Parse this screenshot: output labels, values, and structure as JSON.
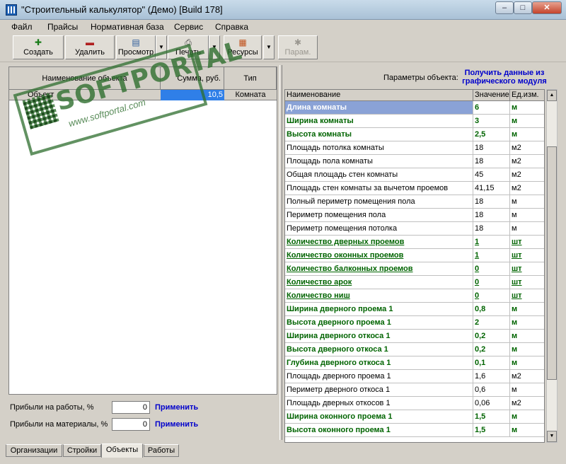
{
  "window": {
    "title": "\"Строительный калькулятор\" (Демо) [Build 178]",
    "minimize": "–",
    "maximize": "□",
    "close": "✕"
  },
  "menu": [
    "Файл",
    "Прайсы",
    "Нормативная база",
    "Сервис",
    "Справка"
  ],
  "toolbar": {
    "create": "Создать",
    "delete": "Удалить",
    "preview": "Просмотр",
    "print": "Печать",
    "resources": "Ресурсы",
    "params": "Парам.",
    "arrow": "▼"
  },
  "left_table": {
    "headers": [
      "Наименование объекта",
      "Сумма, руб.",
      "Тип"
    ],
    "rows": [
      {
        "name": "Объект",
        "sum": "10,5",
        "type": "Комната"
      }
    ]
  },
  "left_bottom": {
    "profit_work_label": "Прибыли на работы, %",
    "profit_work_value": "0",
    "profit_material_label": "Прибыли на материалы, %",
    "profit_material_value": "0",
    "apply": "Применить"
  },
  "tabs": [
    "Организации",
    "Стройки",
    "Объекты",
    "Работы"
  ],
  "right": {
    "params_label": "Параметры объекта:",
    "get_data_link": "Получить данные из графического модуля",
    "headers": [
      "Наименование",
      "Значение",
      "Ед.изм."
    ],
    "rows": [
      {
        "name": "Длина комнаты",
        "value": "6",
        "unit": "м",
        "style": "sel"
      },
      {
        "name": "Ширина комнаты",
        "value": "3",
        "unit": "м",
        "style": "editable"
      },
      {
        "name": "Высота комнаты",
        "value": "2,5",
        "unit": "м",
        "style": "editable"
      },
      {
        "name": "Площадь потолка комнаты",
        "value": "18",
        "unit": "м2",
        "style": "plain"
      },
      {
        "name": "Площадь пола комнаты",
        "value": "18",
        "unit": "м2",
        "style": "plain"
      },
      {
        "name": "Общая площадь стен комнаты",
        "value": "45",
        "unit": "м2",
        "style": "plain"
      },
      {
        "name": "Площадь стен комнаты за вычетом проемов",
        "value": "41,15",
        "unit": "м2",
        "style": "plain"
      },
      {
        "name": "Полный периметр помещения пола",
        "value": "18",
        "unit": "м",
        "style": "plain"
      },
      {
        "name": "Периметр помещения пола",
        "value": "18",
        "unit": "м",
        "style": "plain"
      },
      {
        "name": "Периметр помещения потолка",
        "value": "18",
        "unit": "м",
        "style": "plain"
      },
      {
        "name": "Количество дверных проемов",
        "value": "1",
        "unit": "шт",
        "style": "link"
      },
      {
        "name": "Количество оконных проемов",
        "value": "1",
        "unit": "шт",
        "style": "link"
      },
      {
        "name": "Количество балконных проемов",
        "value": "0",
        "unit": "шт",
        "style": "link"
      },
      {
        "name": "Количество арок",
        "value": "0",
        "unit": "шт",
        "style": "link"
      },
      {
        "name": "Количество ниш",
        "value": "0",
        "unit": "шт",
        "style": "link"
      },
      {
        "name": "Ширина дверного проема 1",
        "value": "0,8",
        "unit": "м",
        "style": "editable"
      },
      {
        "name": "Высота дверного проема 1",
        "value": "2",
        "unit": "м",
        "style": "editable"
      },
      {
        "name": "Ширина дверного откоса 1",
        "value": "0,2",
        "unit": "м",
        "style": "editable"
      },
      {
        "name": "Высота дверного откоса 1",
        "value": "0,2",
        "unit": "м",
        "style": "editable"
      },
      {
        "name": "Глубина дверного откоса 1",
        "value": "0,1",
        "unit": "м",
        "style": "editable"
      },
      {
        "name": "Площадь дверного проема 1",
        "value": "1,6",
        "unit": "м2",
        "style": "plain"
      },
      {
        "name": "Периметр дверного откоса 1",
        "value": "0,6",
        "unit": "м",
        "style": "plain"
      },
      {
        "name": "Площадь дверных откосов 1",
        "value": "0,06",
        "unit": "м2",
        "style": "plain"
      },
      {
        "name": "Ширина оконного проема 1",
        "value": "1,5",
        "unit": "м",
        "style": "editable"
      },
      {
        "name": "Высота оконного проема 1",
        "value": "1,5",
        "unit": "м",
        "style": "editable"
      }
    ]
  },
  "watermark": {
    "text": "SOFTPORTAL",
    "url": "www.softportal.com"
  },
  "colors": {
    "accent_link": "#0000cc",
    "editable_green": "#006400",
    "selection": "#8aa2d6"
  }
}
